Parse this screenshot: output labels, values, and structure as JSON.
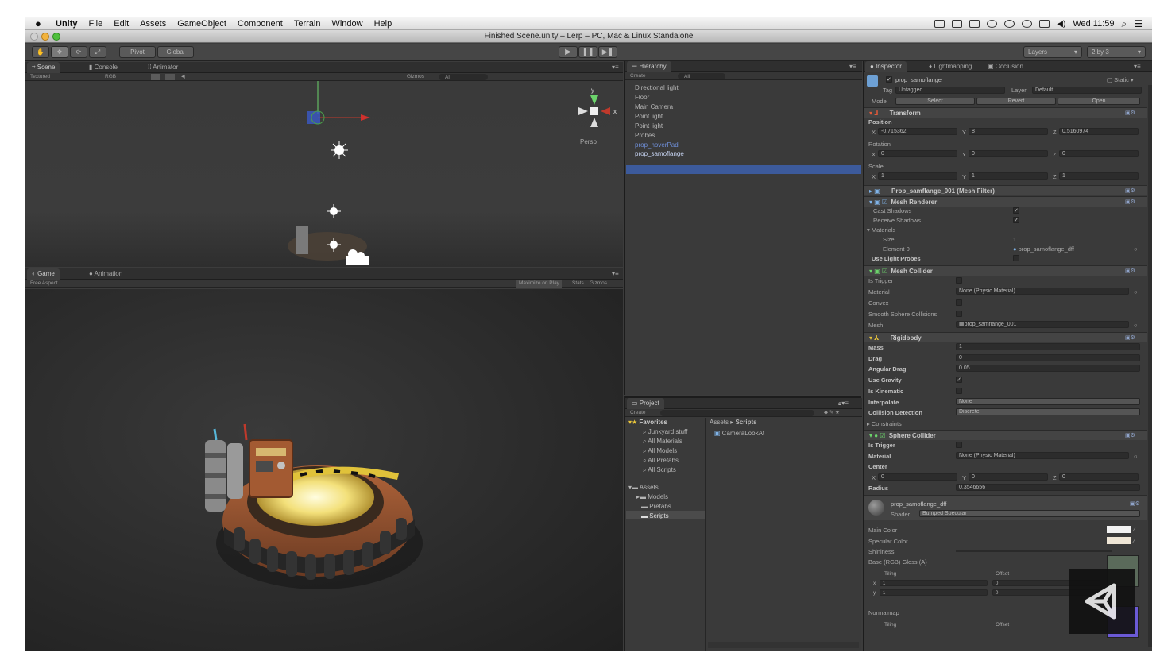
{
  "menubar": {
    "app": "Unity",
    "items": [
      "File",
      "Edit",
      "Assets",
      "GameObject",
      "Component",
      "Terrain",
      "Window",
      "Help"
    ],
    "clock": "Wed 11:59"
  },
  "window": {
    "title": "Finished Scene.unity – Lerp – PC, Mac & Linux Standalone"
  },
  "toolbar": {
    "pivot": "Pivot",
    "global": "Global",
    "layers": "Layers",
    "layout": "2 by 3"
  },
  "scene_panel": {
    "tabs": [
      "Scene",
      "Console",
      "Animator"
    ],
    "shading": "Textured",
    "render": "RGB",
    "gizmos": "Gizmos",
    "search": "All",
    "persp": "Persp",
    "axis_x": "x",
    "axis_y": "y"
  },
  "game_panel": {
    "tabs": [
      "Game",
      "Animation"
    ],
    "aspect": "Free Aspect",
    "maximize": "Maximize on Play",
    "stats": "Stats",
    "gizmos": "Gizmos"
  },
  "hierarchy": {
    "tab": "Hierarchy",
    "create": "Create",
    "search": "All",
    "items": [
      "Directional light",
      "Floor",
      "Main Camera",
      "Point light",
      "Point light",
      "Probes",
      "prop_hoverPad",
      "prop_samoflange"
    ],
    "selected_index": 7
  },
  "project": {
    "tab": "Project",
    "create": "Create",
    "favorites_label": "Favorites",
    "favorites": [
      "Junkyard stuff",
      "All Materials",
      "All Models",
      "All Prefabs",
      "All Scripts"
    ],
    "assets_label": "Assets",
    "folders": [
      "Models",
      "Prefabs",
      "Scripts"
    ],
    "breadcrumb": [
      "Assets",
      "Scripts"
    ],
    "files": [
      "CameraLookAt"
    ]
  },
  "inspector": {
    "tabs": [
      "Inspector",
      "Lightmapping",
      "Occlusion"
    ],
    "object_name": "prop_samoflange",
    "static": "Static",
    "tag_label": "Tag",
    "tag": "Untagged",
    "layer_label": "Layer",
    "layer": "Default",
    "model_label": "Model",
    "model_buttons": [
      "Select",
      "Revert",
      "Open"
    ],
    "transform": {
      "title": "Transform",
      "position_label": "Position",
      "rotation_label": "Rotation",
      "scale_label": "Scale",
      "position": {
        "x": "-0.715362",
        "y": "8",
        "z": "0.5160974"
      },
      "rotation": {
        "x": "0",
        "y": "0",
        "z": "0"
      },
      "scale": {
        "x": "1",
        "y": "1",
        "z": "1"
      }
    },
    "mesh_filter": "Prop_samflange_001 (Mesh Filter)",
    "mesh_renderer": {
      "title": "Mesh Renderer",
      "cast_shadows": "Cast Shadows",
      "receive_shadows": "Receive Shadows",
      "materials": "Materials",
      "size_label": "Size",
      "size": "1",
      "element0_label": "Element 0",
      "element0": "prop_samoflange_dff",
      "light_probes": "Use Light Probes"
    },
    "mesh_collider": {
      "title": "Mesh Collider",
      "is_trigger": "Is Trigger",
      "material_label": "Material",
      "material": "None (Physic Material)",
      "convex": "Convex",
      "smooth": "Smooth Sphere Collisions",
      "mesh_label": "Mesh",
      "mesh": "prop_samflange_001"
    },
    "rigidbody": {
      "title": "Rigidbody",
      "mass_label": "Mass",
      "mass": "1",
      "drag_label": "Drag",
      "drag": "0",
      "angular_label": "Angular Drag",
      "angular": "0.05",
      "gravity_label": "Use Gravity",
      "kinematic_label": "Is Kinematic",
      "interpolate_label": "Interpolate",
      "interpolate": "None",
      "collision_label": "Collision Detection",
      "collision": "Discrete",
      "constraints": "Constraints"
    },
    "sphere_collider": {
      "title": "Sphere Collider",
      "is_trigger": "Is Trigger",
      "material_label": "Material",
      "material": "None (Physic Material)",
      "center_label": "Center",
      "center": {
        "x": "0",
        "y": "0",
        "z": "0"
      },
      "radius_label": "Radius",
      "radius": "0.3546656"
    },
    "material": {
      "name": "prop_samoflange_dff",
      "shader_label": "Shader",
      "shader": "Bumped Specular",
      "main_color": "Main Color",
      "spec_color": "Specular Color",
      "shininess": "Shininess",
      "base": "Base (RGB) Gloss (A)",
      "tiling": "Tiling",
      "offset": "Offset",
      "tx": "1",
      "ty": "1",
      "ox": "0",
      "oy": "0",
      "normalmap": "Normalmap",
      "tiling2": "Tiling",
      "offset2": "Offset"
    },
    "colors": {
      "main": "#f2f2f2",
      "specular": "#efe6d6"
    }
  },
  "labels": {
    "x": "X",
    "y": "Y",
    "z": "Z"
  }
}
